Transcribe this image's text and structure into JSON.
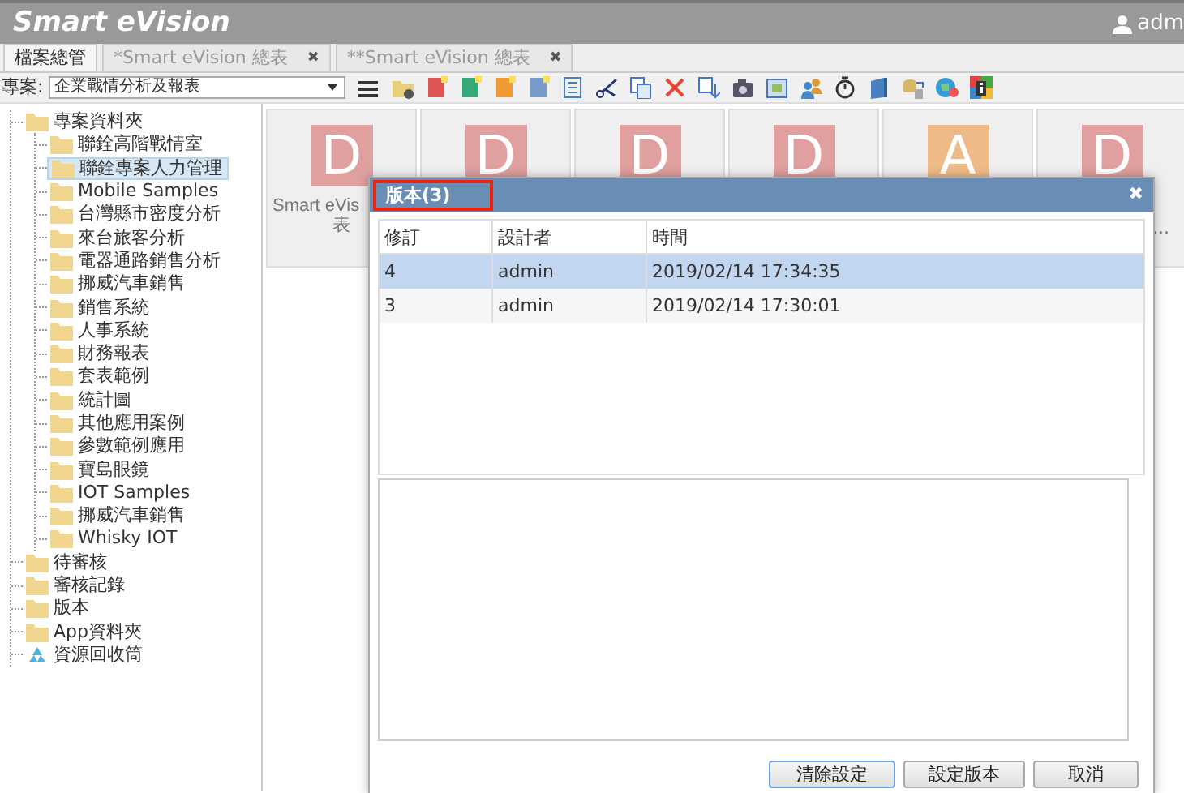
{
  "app": {
    "title": "Smart eVision",
    "user": "adm"
  },
  "tabs": [
    {
      "label": "檔案總管",
      "selected": true
    },
    {
      "label": "*Smart eVision 總表",
      "selected": false,
      "close": "✖"
    },
    {
      "label": "**Smart eVision 總表",
      "selected": false,
      "close": "✖"
    }
  ],
  "toolbar": {
    "project_label": "專案:",
    "project": "企業戰情分析及報表"
  },
  "tree": [
    {
      "label": "專案資料夾",
      "expanded": true,
      "selected": false,
      "children": [
        {
          "label": "聯銓高階戰情室",
          "selected": false
        },
        {
          "label": "聯銓專案人力管理",
          "selected": true
        },
        {
          "label": "Mobile Samples",
          "selected": false
        },
        {
          "label": "台灣縣市密度分析",
          "selected": false
        },
        {
          "label": "來台旅客分析",
          "selected": false
        },
        {
          "label": "電器通路銷售分析",
          "selected": false
        },
        {
          "label": "挪威汽車銷售",
          "selected": false
        },
        {
          "label": "銷售系統",
          "selected": false
        },
        {
          "label": "人事系統",
          "selected": false
        },
        {
          "label": "財務報表",
          "selected": false
        },
        {
          "label": "套表範例",
          "selected": false
        },
        {
          "label": "統計圖",
          "selected": false
        },
        {
          "label": "其他應用案例",
          "selected": false
        },
        {
          "label": "參數範例應用",
          "selected": false
        },
        {
          "label": "寶島眼鏡",
          "selected": false
        },
        {
          "label": "IOT Samples",
          "selected": false
        },
        {
          "label": "挪威汽車銷售",
          "selected": false
        },
        {
          "label": "Whisky IOT",
          "selected": false
        }
      ]
    },
    {
      "label": "待審核",
      "selected": false
    },
    {
      "label": "審核記錄",
      "selected": false
    },
    {
      "label": "版本",
      "selected": false
    },
    {
      "label": "App資料夾",
      "selected": false
    },
    {
      "label": "資源回收筒",
      "kind": "recycle",
      "selected": false
    }
  ],
  "cards": [
    {
      "letter": "D",
      "color": "#e0a0a0",
      "label_lines": [
        "Smart eVis",
        "表"
      ]
    },
    {
      "letter": "D",
      "color": "#e0a0a0"
    },
    {
      "letter": "D",
      "color": "#e0a0a0"
    },
    {
      "letter": "D",
      "color": "#e0a0a0"
    },
    {
      "letter": "A",
      "color": "#eebb88"
    },
    {
      "letter": "D",
      "color": "#e0a0a0",
      "label_lines": [
        "..."
      ]
    }
  ],
  "dialog": {
    "title": "版本(3)",
    "close": "✖",
    "columns": [
      "修訂",
      "設計者",
      "時間"
    ],
    "rows": [
      {
        "cells": [
          "4",
          "admin",
          "2019/02/14 17:34:35"
        ],
        "selected": true
      },
      {
        "cells": [
          "3",
          "admin",
          "2019/02/14 17:30:01"
        ],
        "selected": false
      }
    ],
    "buttons": [
      {
        "label": "清除設定",
        "focused": true
      },
      {
        "label": "設定版本",
        "focused": false
      },
      {
        "label": "取消",
        "focused": false
      }
    ]
  }
}
